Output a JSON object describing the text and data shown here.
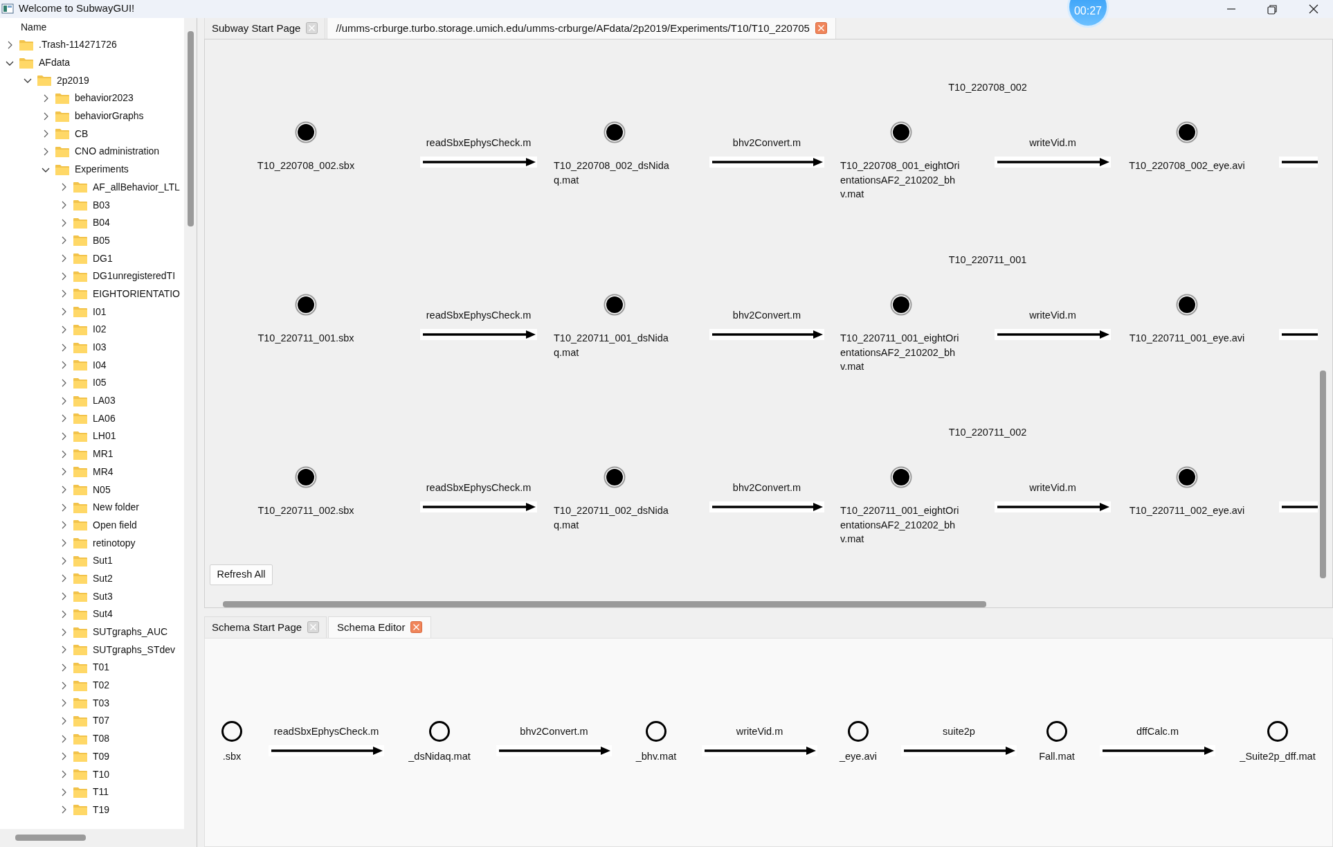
{
  "window": {
    "title": "Welcome to SubwayGUI!"
  },
  "timer": "00:27",
  "file_tree": {
    "header": "Name",
    "items": [
      {
        "label": ".Trash-114271726",
        "expanded": false
      },
      {
        "label": "AFdata",
        "expanded": true,
        "children": [
          {
            "label": "2p2019",
            "expanded": true,
            "children": [
              {
                "label": "behavior2023",
                "expanded": false
              },
              {
                "label": "behaviorGraphs",
                "expanded": false
              },
              {
                "label": "CB",
                "expanded": false
              },
              {
                "label": "CNO administration",
                "expanded": false
              },
              {
                "label": "Experiments",
                "expanded": true,
                "children": [
                  {
                    "label": "AF_allBehavior_LTL",
                    "expanded": false
                  },
                  {
                    "label": "B03",
                    "expanded": false
                  },
                  {
                    "label": "B04",
                    "expanded": false
                  },
                  {
                    "label": "B05",
                    "expanded": false
                  },
                  {
                    "label": "DG1",
                    "expanded": false
                  },
                  {
                    "label": "DG1unregisteredTI",
                    "expanded": false
                  },
                  {
                    "label": "EIGHTORIENTATIO",
                    "expanded": false
                  },
                  {
                    "label": "I01",
                    "expanded": false
                  },
                  {
                    "label": "I02",
                    "expanded": false
                  },
                  {
                    "label": "I03",
                    "expanded": false
                  },
                  {
                    "label": "I04",
                    "expanded": false
                  },
                  {
                    "label": "I05",
                    "expanded": false
                  },
                  {
                    "label": "LA03",
                    "expanded": false
                  },
                  {
                    "label": "LA06",
                    "expanded": false
                  },
                  {
                    "label": "LH01",
                    "expanded": false
                  },
                  {
                    "label": "MR1",
                    "expanded": false
                  },
                  {
                    "label": "MR4",
                    "expanded": false
                  },
                  {
                    "label": "N05",
                    "expanded": false
                  },
                  {
                    "label": "New folder",
                    "expanded": false
                  },
                  {
                    "label": "Open field",
                    "expanded": false
                  },
                  {
                    "label": "retinotopy",
                    "expanded": false
                  },
                  {
                    "label": "Sut1",
                    "expanded": false
                  },
                  {
                    "label": "Sut2",
                    "expanded": false
                  },
                  {
                    "label": "Sut3",
                    "expanded": false
                  },
                  {
                    "label": "Sut4",
                    "expanded": false
                  },
                  {
                    "label": "SUTgraphs_AUC",
                    "expanded": false
                  },
                  {
                    "label": "SUTgraphs_STdev",
                    "expanded": false
                  },
                  {
                    "label": "T01",
                    "expanded": false
                  },
                  {
                    "label": "T02",
                    "expanded": false
                  },
                  {
                    "label": "T03",
                    "expanded": false
                  },
                  {
                    "label": "T07",
                    "expanded": false
                  },
                  {
                    "label": "T08",
                    "expanded": false
                  },
                  {
                    "label": "T09",
                    "expanded": false
                  },
                  {
                    "label": "T10",
                    "expanded": false
                  },
                  {
                    "label": "T11",
                    "expanded": false
                  },
                  {
                    "label": "T19",
                    "expanded": false
                  }
                ]
              }
            ]
          }
        ]
      }
    ]
  },
  "top_tabs": [
    {
      "label": "Subway Start Page",
      "selected": false
    },
    {
      "label": "//umms-crburge.turbo.storage.umich.edu/umms-crburge/AFdata/2p2019/Experiments/T10/T10_220705",
      "selected": true
    }
  ],
  "pipelines": [
    {
      "title": "T10_220708_002",
      "steps": [
        {
          "kind": "node",
          "label": "T10_220708_002.sbx",
          "filled": true
        },
        {
          "kind": "arrow",
          "label": "readSbxEphysCheck.m"
        },
        {
          "kind": "node",
          "label": "T10_220708_002_dsNidaq.mat",
          "filled": true
        },
        {
          "kind": "arrow",
          "label": "bhv2Convert.m"
        },
        {
          "kind": "node",
          "label": "T10_220708_001_eightOrientationsAF2_210202_bhv.mat",
          "filled": true
        },
        {
          "kind": "arrow",
          "label": "writeVid.m"
        },
        {
          "kind": "node",
          "label": "T10_220708_002_eye.avi",
          "filled": true
        },
        {
          "kind": "arrow",
          "cut": true
        }
      ]
    },
    {
      "title": "T10_220711_001",
      "steps": [
        {
          "kind": "node",
          "label": "T10_220711_001.sbx",
          "filled": true
        },
        {
          "kind": "arrow",
          "label": "readSbxEphysCheck.m"
        },
        {
          "kind": "node",
          "label": "T10_220711_001_dsNidaq.mat",
          "filled": true
        },
        {
          "kind": "arrow",
          "label": "bhv2Convert.m"
        },
        {
          "kind": "node",
          "label": "T10_220711_001_eightOrientationsAF2_210202_bhv.mat",
          "filled": true
        },
        {
          "kind": "arrow",
          "label": "writeVid.m"
        },
        {
          "kind": "node",
          "label": "T10_220711_001_eye.avi",
          "filled": true
        },
        {
          "kind": "arrow",
          "cut": true
        }
      ]
    },
    {
      "title": "T10_220711_002",
      "steps": [
        {
          "kind": "node",
          "label": "T10_220711_002.sbx",
          "filled": true
        },
        {
          "kind": "arrow",
          "label": "readSbxEphysCheck.m"
        },
        {
          "kind": "node",
          "label": "T10_220711_002_dsNidaq.mat",
          "filled": true
        },
        {
          "kind": "arrow",
          "label": "bhv2Convert.m"
        },
        {
          "kind": "node",
          "label": "T10_220711_001_eightOrientationsAF2_210202_bhv.mat",
          "filled": true
        },
        {
          "kind": "arrow",
          "label": "writeVid.m"
        },
        {
          "kind": "node",
          "label": "T10_220711_002_eye.avi",
          "filled": true
        },
        {
          "kind": "arrow",
          "cut": true
        }
      ]
    }
  ],
  "refresh_button": "Refresh All",
  "bottom_tabs": [
    {
      "label": "Schema Start Page",
      "selected": false
    },
    {
      "label": "Schema Editor",
      "selected": true
    }
  ],
  "schema": {
    "steps": [
      {
        "kind": "node",
        "label": ".sbx",
        "filled": false
      },
      {
        "kind": "arrow",
        "label": "readSbxEphysCheck.m"
      },
      {
        "kind": "node",
        "label": "_dsNidaq.mat",
        "filled": false
      },
      {
        "kind": "arrow",
        "label": "bhv2Convert.m"
      },
      {
        "kind": "node",
        "label": "_bhv.mat",
        "filled": false
      },
      {
        "kind": "arrow",
        "label": "writeVid.m"
      },
      {
        "kind": "node",
        "label": "_eye.avi",
        "filled": false
      },
      {
        "kind": "arrow",
        "label": "suite2p"
      },
      {
        "kind": "node",
        "label": "Fall.mat",
        "filled": false
      },
      {
        "kind": "arrow",
        "label": "dffCalc.m"
      },
      {
        "kind": "node",
        "label": "_Suite2p_dff.mat",
        "filled": false
      }
    ]
  }
}
